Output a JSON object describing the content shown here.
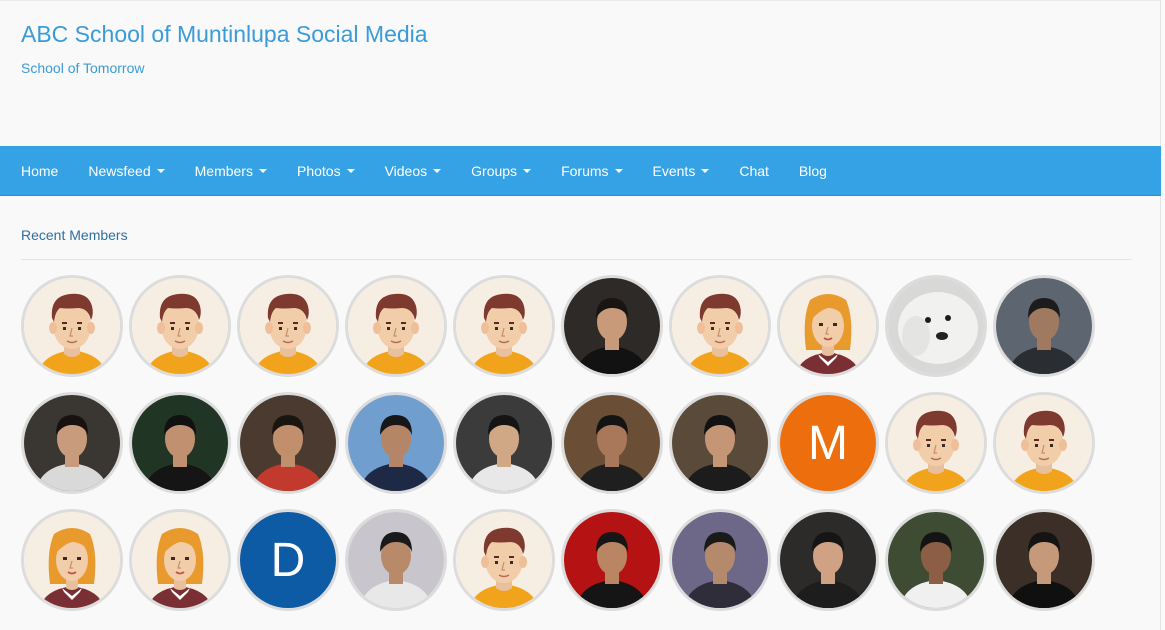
{
  "site": {
    "title": "ABC School of Muntinlupa Social Media",
    "tagline": "School of Tomorrow"
  },
  "nav": [
    {
      "label": "Home",
      "dropdown": false
    },
    {
      "label": "Newsfeed",
      "dropdown": true
    },
    {
      "label": "Members",
      "dropdown": true
    },
    {
      "label": "Photos",
      "dropdown": true
    },
    {
      "label": "Videos",
      "dropdown": true
    },
    {
      "label": "Groups",
      "dropdown": true
    },
    {
      "label": "Forums",
      "dropdown": true
    },
    {
      "label": "Events",
      "dropdown": true
    },
    {
      "label": "Chat",
      "dropdown": false
    },
    {
      "label": "Blog",
      "dropdown": false
    }
  ],
  "section": {
    "title": "Recent Members"
  },
  "colors": {
    "title": "#3a9bd8",
    "navbar": "#36a2e6",
    "avatar_border": "#dcdcdc"
  },
  "members": [
    {
      "kind": "default-male"
    },
    {
      "kind": "default-male"
    },
    {
      "kind": "default-male"
    },
    {
      "kind": "default-male"
    },
    {
      "kind": "default-male"
    },
    {
      "kind": "photo",
      "bg": "#2e2a27",
      "skin": "#c89a7a",
      "hair": "#1a1412",
      "shirt": "#121212"
    },
    {
      "kind": "default-male"
    },
    {
      "kind": "default-female"
    },
    {
      "kind": "photo-dog"
    },
    {
      "kind": "photo",
      "bg": "#5d6670",
      "skin": "#a07a60",
      "hair": "#1c1c1c",
      "shirt": "#2a2e33"
    },
    {
      "kind": "photo",
      "bg": "#3a3631",
      "skin": "#c79b7c",
      "hair": "#17120f",
      "shirt": "#d9d9d9"
    },
    {
      "kind": "photo",
      "bg": "#203524",
      "skin": "#c09071",
      "hair": "#111111",
      "shirt": "#151515"
    },
    {
      "kind": "photo",
      "bg": "#4a3a30",
      "skin": "#c28f6d",
      "hair": "#1b1511",
      "shirt": "#c23a2d"
    },
    {
      "kind": "photo",
      "bg": "#6f9ecf",
      "skin": "#b48566",
      "hair": "#171717",
      "shirt": "#1e2a45"
    },
    {
      "kind": "photo",
      "bg": "#3b3b3b",
      "skin": "#d1a886",
      "hair": "#141414",
      "shirt": "#e8e8e8"
    },
    {
      "kind": "photo",
      "bg": "#6a4e35",
      "skin": "#a9785a",
      "hair": "#141414",
      "shirt": "#1f1f1f"
    },
    {
      "kind": "photo",
      "bg": "#5a4a3a",
      "skin": "#c49675",
      "hair": "#121212",
      "shirt": "#1c1c1c"
    },
    {
      "kind": "letter",
      "letter": "M",
      "bg": "#ed6e0c"
    },
    {
      "kind": "default-male"
    },
    {
      "kind": "default-male"
    },
    {
      "kind": "default-female"
    },
    {
      "kind": "default-female"
    },
    {
      "kind": "letter",
      "letter": "D",
      "bg": "#0d5aa5"
    },
    {
      "kind": "photo",
      "bg": "#c8c6cc",
      "skin": "#b88a6a",
      "hair": "#1a1a1a",
      "shirt": "#e8e8e8"
    },
    {
      "kind": "default-male"
    },
    {
      "kind": "photo",
      "bg": "#b51313",
      "skin": "#b98562",
      "hair": "#161616",
      "shirt": "#151515"
    },
    {
      "kind": "photo",
      "bg": "#6d6888",
      "skin": "#b58a6c",
      "hair": "#1a1a1a",
      "shirt": "#2f2d3a"
    },
    {
      "kind": "photo",
      "bg": "#2d2b2a",
      "skin": "#d0a283",
      "hair": "#151515",
      "shirt": "#1d1d1d"
    },
    {
      "kind": "photo",
      "bg": "#3d4c33",
      "skin": "#8b5e45",
      "hair": "#141414",
      "shirt": "#f0f0f0"
    },
    {
      "kind": "photo",
      "bg": "#3b2f28",
      "skin": "#c5997a",
      "hair": "#141414",
      "shirt": "#101010"
    }
  ]
}
